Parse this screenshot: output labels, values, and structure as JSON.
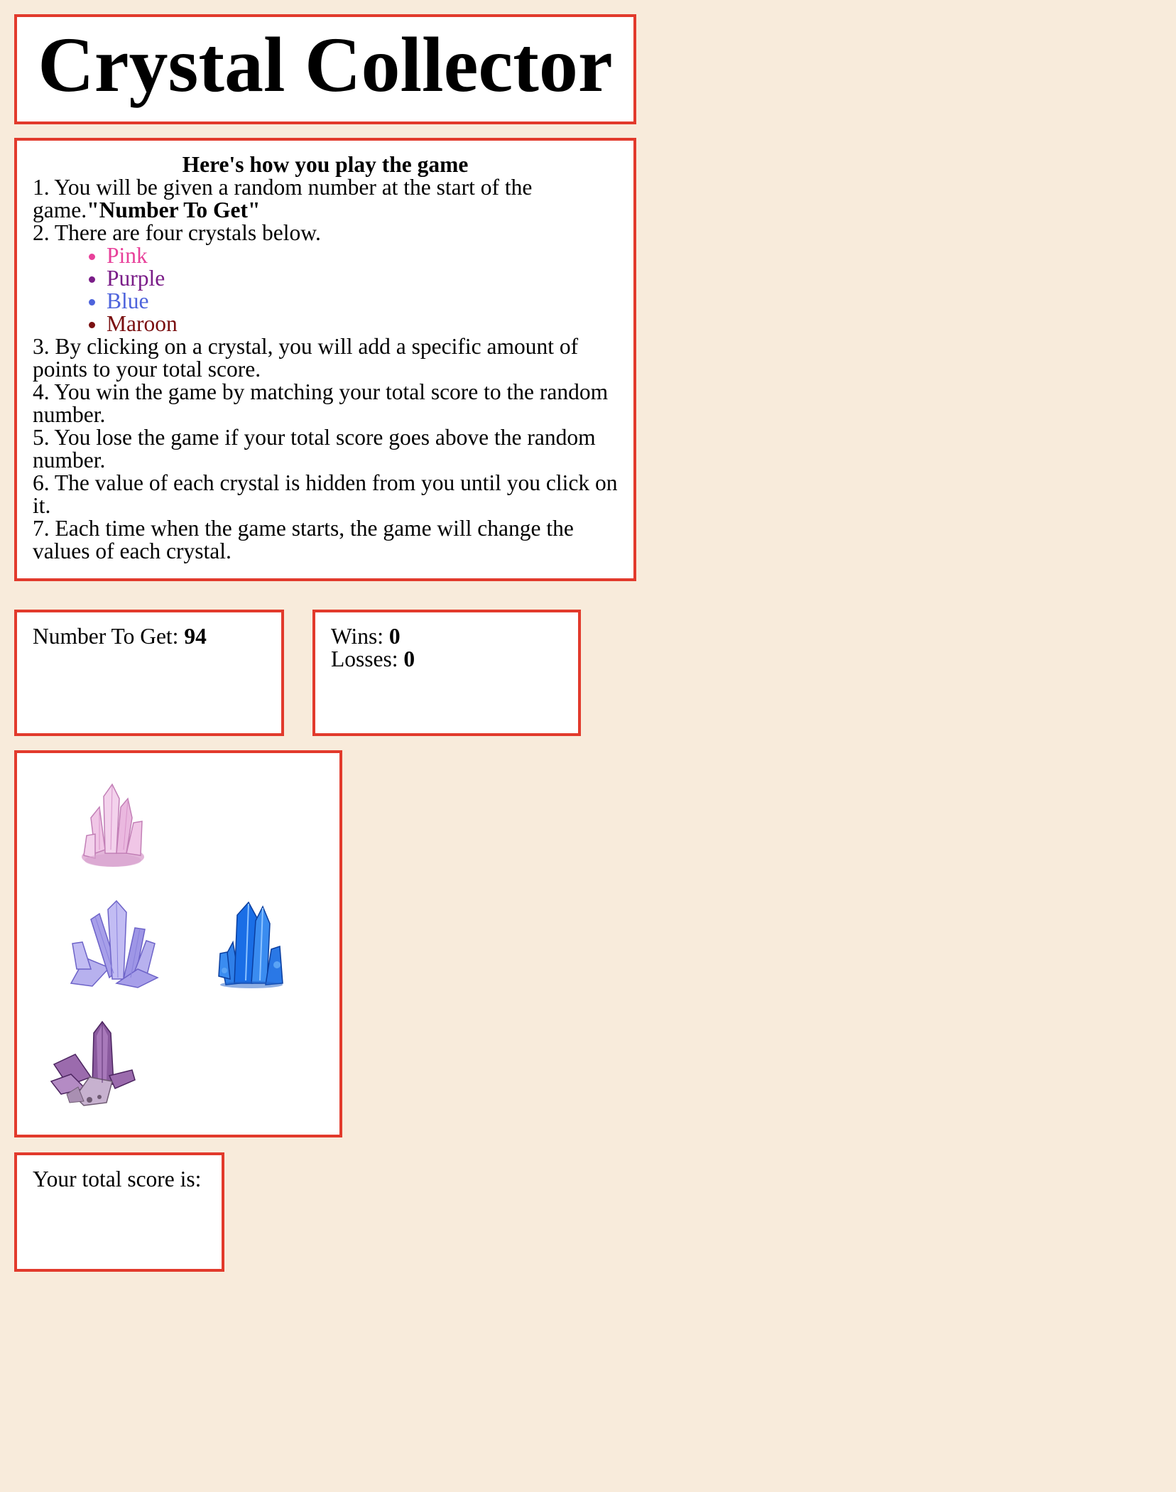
{
  "header": {
    "title": "Crystal Collector"
  },
  "rules": {
    "heading": "Here's how you play the game",
    "rule1_prefix": "1. You will be given a random number at the start of the game.",
    "rule1_bold": "\"Number To Get\"",
    "rule2": "2. There are four crystals below.",
    "crystal_colors": [
      {
        "label": "Pink",
        "color": "#e8409a"
      },
      {
        "label": "Purple",
        "color": "#7a1d88"
      },
      {
        "label": "Blue",
        "color": "#4d63dc"
      },
      {
        "label": "Maroon",
        "color": "#7a0f10"
      }
    ],
    "rule3": "3. By clicking on a crystal, you will add a specific amount of points to your total score.",
    "rule4": "4. You win the game by matching your total score to the random number.",
    "rule5": "5. You lose the game if your total score goes above the random number.",
    "rule6": "6. The value of each crystal is hidden from you until you click on it.",
    "rule7": "7. Each time when the game starts, the game will change the values of each crystal."
  },
  "target": {
    "label": "Number To Get: ",
    "value": "94"
  },
  "stats": {
    "wins_label": "Wins: ",
    "wins_value": "0",
    "losses_label": "Losses: ",
    "losses_value": "0"
  },
  "crystals": [
    {
      "name": "pink-crystal-icon",
      "color": "#e7a8d6"
    },
    {
      "name": "lavender-crystal-icon",
      "color": "#8f86e0"
    },
    {
      "name": "blue-crystal-icon",
      "color": "#1f6fe6"
    },
    {
      "name": "amethyst-crystal-icon",
      "color": "#8a5a9e"
    }
  ],
  "score": {
    "label": "Your total score is:",
    "value": ""
  },
  "colors": {
    "background": "#f8ebdb",
    "panel_border": "#e23a2c",
    "panel_background": "#ffffff"
  }
}
